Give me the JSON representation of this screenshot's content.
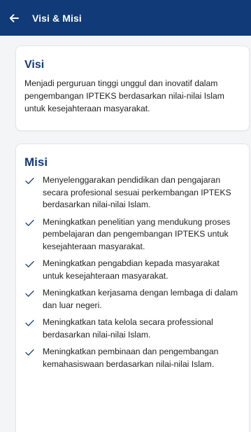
{
  "appbar": {
    "title": "Visi & Misi",
    "back_icon": "arrow-left-icon"
  },
  "visi": {
    "title": "Visi",
    "text": "Menjadi perguruan tinggi unggul dan inovatif dalam pengembangan IPTEKS berdasarkan nilai-nilai Islam untuk kesejahteraan masyarakat."
  },
  "misi": {
    "title": "Misi",
    "items": [
      "Menyelenggarakan pendidikan dan pengajaran secara profesional sesuai perkembangan IPTEKS berdasarkan nilai-nilai Islam.",
      "Meningkatkan penelitian yang mendukung proses pembelajaran dan pengembangan IPTEKS untuk kesejahteraan masyarakat.",
      "Meningkatkan pengabdian kepada masyarakat untuk kesejahteraan masyarakat.",
      "Meningkatkan kerjasama dengan lembaga di dalam dan luar negeri.",
      "Meningkatkan tata kelola secara professional berdasarkan nilai-nilai Islam.",
      "Meningkatkan pembinaan dan pengembangan kemahasiswaan berdasarkan nilai-nilai Islam."
    ]
  },
  "colors": {
    "appbar": "#103a78",
    "title": "#103a78",
    "check": "#103a78",
    "background": "#f4f5f7"
  }
}
